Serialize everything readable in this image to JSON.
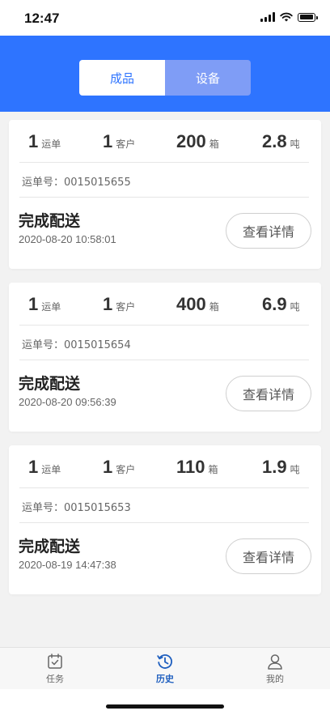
{
  "status_bar": {
    "time": "12:47"
  },
  "segment": {
    "tabs": [
      "成品",
      "设备"
    ],
    "active_index": 0
  },
  "colors": {
    "brand_blue": "#2e74ff",
    "segment_inactive": "#7f9df6",
    "tab_active": "#1f5fbf"
  },
  "orders": [
    {
      "shipments": "1",
      "shipments_unit": "运单",
      "customers": "1",
      "customers_unit": "客户",
      "boxes": "200",
      "boxes_unit": "箱",
      "weight": "2.8",
      "weight_unit": "吨",
      "order_no": "运单号：0015015655",
      "status": "完成配送",
      "time": "2020-08-20 10:58:01",
      "detail_label": "查看详情"
    },
    {
      "shipments": "1",
      "shipments_unit": "运单",
      "customers": "1",
      "customers_unit": "客户",
      "boxes": "400",
      "boxes_unit": "箱",
      "weight": "6.9",
      "weight_unit": "吨",
      "order_no": "运单号：0015015654",
      "status": "完成配送",
      "time": "2020-08-20 09:56:39",
      "detail_label": "查看详情"
    },
    {
      "shipments": "1",
      "shipments_unit": "运单",
      "customers": "1",
      "customers_unit": "客户",
      "boxes": "110",
      "boxes_unit": "箱",
      "weight": "1.9",
      "weight_unit": "吨",
      "order_no": "运单号：0015015653",
      "status": "完成配送",
      "time": "2020-08-19 14:47:38",
      "detail_label": "查看详情"
    }
  ],
  "tabbar": [
    {
      "label": "任务",
      "icon": "calendar-check-icon",
      "active": false
    },
    {
      "label": "历史",
      "icon": "history-clock-icon",
      "active": true
    },
    {
      "label": "我的",
      "icon": "user-icon",
      "active": false
    }
  ]
}
